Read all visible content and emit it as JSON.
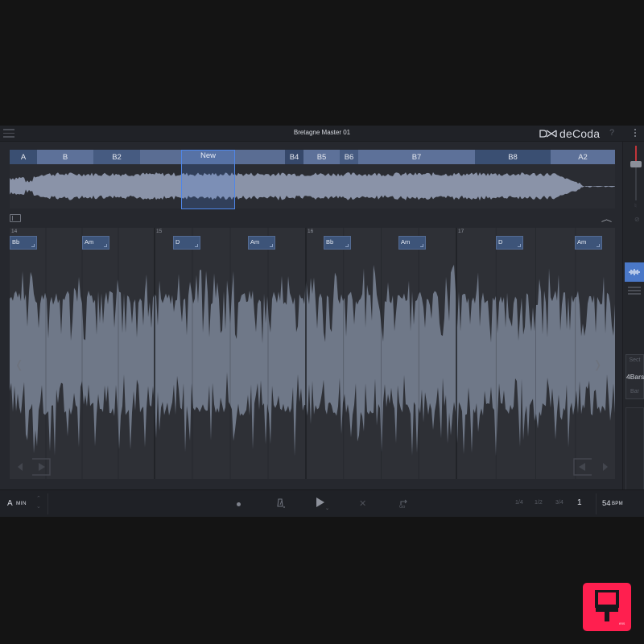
{
  "app": {
    "document_title": "Bretagne Master 01",
    "logo_text": "deCoda"
  },
  "overview": {
    "sections": [
      {
        "label": "A",
        "color": "#3a4f72"
      },
      {
        "label": "B",
        "color": "#5d7199"
      },
      {
        "label": "B2",
        "color": "#465b81"
      },
      {
        "label": "",
        "color": "#5a6d93"
      },
      {
        "label": "B4",
        "color": "#36486a"
      },
      {
        "label": "B5",
        "color": "#5d7199"
      },
      {
        "label": "B6",
        "color": "#465b81"
      },
      {
        "label": "B7",
        "color": "#5d7199"
      },
      {
        "label": "B8",
        "color": "#3a4f72"
      },
      {
        "label": "A2",
        "color": "#5d7199"
      }
    ],
    "selection_label": "New",
    "selection_color": "#4f86e8"
  },
  "detail": {
    "bars": [
      {
        "number": "14",
        "chords": [
          "Bb",
          "Am"
        ]
      },
      {
        "number": "15",
        "chords": [
          "D",
          "Am"
        ]
      },
      {
        "number": "16",
        "chords": [
          "Bb",
          "Am"
        ]
      },
      {
        "number": "17",
        "chords": [
          "D",
          "Am"
        ]
      }
    ],
    "chord_color": "#3d5479",
    "waveform_color": "#6f7888"
  },
  "sidebar": {
    "loop_length_label": "4Bars",
    "loop_shorter_label": "Sect",
    "loop_longer_label": "Bar",
    "volume_color": "#c0353a",
    "wave_mode_color": "#4a78c8"
  },
  "transport": {
    "key_letter": "A",
    "key_mode": "MIN",
    "goto_label": "Go",
    "speeds": [
      "1/4",
      "1/2",
      "3/4",
      "1"
    ],
    "selected_speed": "1",
    "tempo_value": "54",
    "tempo_unit": "BPM",
    "icons": [
      "record-icon",
      "metronome-icon",
      "play-icon",
      "shuffle-icon",
      "goto-icon"
    ]
  },
  "badge": {
    "sub_label": "ens",
    "color": "#ff1f4f"
  }
}
